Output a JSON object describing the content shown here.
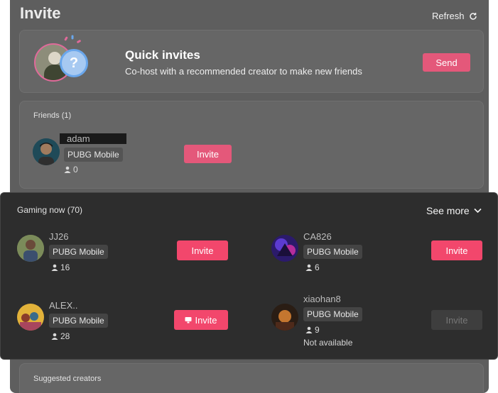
{
  "title": "Invite",
  "refresh_label": "Refresh",
  "quick_invites": {
    "title": "Quick invites",
    "subtitle": "Co-host with a recommended creator to make new friends",
    "send_label": "Send",
    "placeholder_glyph": "?"
  },
  "friends": {
    "header": "Friends (1)",
    "items": [
      {
        "name": "adam",
        "game": "PUBG Mobile",
        "count": "0",
        "invite_label": "Invite"
      }
    ]
  },
  "gaming_now": {
    "header": "Gaming now (70)",
    "see_more_label": "See more",
    "items": [
      {
        "name": "JJ26",
        "game": "PUBG Mobile",
        "count": "16",
        "invite_label": "Invite"
      },
      {
        "name": "CA826",
        "game": "PUBG Mobile",
        "count": "6",
        "invite_label": "Invite"
      },
      {
        "name": "ALEX..",
        "game": "PUBG Mobile",
        "count": "28",
        "invite_label": "Invite"
      },
      {
        "name": "xiaohan8",
        "game": "PUBG Mobile",
        "count": "9",
        "invite_label": "Invite",
        "status": "Not available"
      }
    ]
  },
  "suggested": {
    "header": "Suggested creators"
  },
  "colors": {
    "accent": "#f2476c",
    "panel": "#5e5e5e",
    "card": "#666666",
    "overlay": "#2d2d2d"
  }
}
